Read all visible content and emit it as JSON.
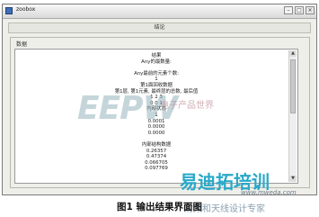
{
  "window": {
    "title": "zoobox",
    "buttons": {
      "minimize": "–",
      "maximize": "□",
      "close": "×"
    }
  },
  "caption_bar": {
    "text": "结论"
  },
  "group": {
    "label": "数据",
    "lines": [
      "结果",
      "Any的最数量:",
      "",
      "Any最前的元素个数:",
      "1",
      "第1面回收数据",
      "第1层, 第1元素, 最终层的总数, 最后值",
      "1 2 3",
      "0 0 1",
      "内部状态",
      "1",
      "0.0001",
      "0.0000",
      "0.0000",
      "",
      "内部结构数据",
      "0.26357",
      "0.47374",
      "0.066705",
      "0.097769"
    ]
  },
  "watermark": {
    "logo": "EEPW",
    "chinese": "电子产品世界",
    "brand": "易迪拓培训",
    "brand_sub": "射频和天线设计专家",
    "url": "www.mweda.com"
  },
  "figure_caption": "图1 输出结果界面图"
}
